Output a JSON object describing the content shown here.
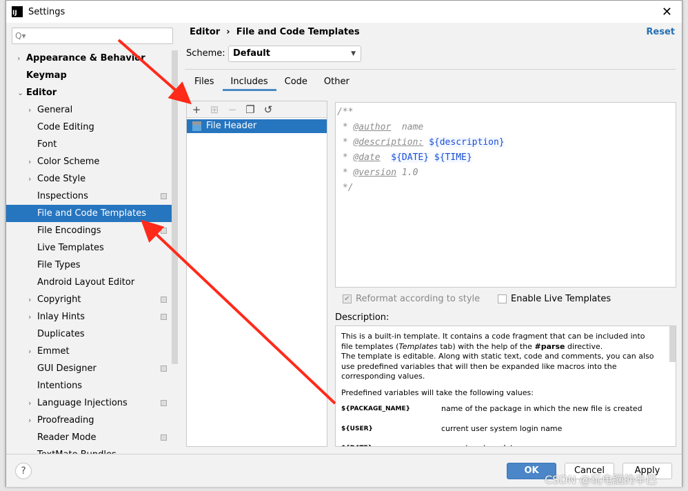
{
  "window": {
    "title": "Settings",
    "logo": "IJ"
  },
  "search": {
    "placeholder": "Q▾"
  },
  "tree": [
    {
      "label": "Appearance & Behavior",
      "level": 0,
      "arrow": "›",
      "bold": true
    },
    {
      "label": "Keymap",
      "level": 0,
      "bold": true
    },
    {
      "label": "Editor",
      "level": 0,
      "arrow": "⌄",
      "bold": true
    },
    {
      "label": "General",
      "level": 1,
      "arrow": "›"
    },
    {
      "label": "Code Editing",
      "level": 1
    },
    {
      "label": "Font",
      "level": 1
    },
    {
      "label": "Color Scheme",
      "level": 1,
      "arrow": "›"
    },
    {
      "label": "Code Style",
      "level": 1,
      "arrow": "›"
    },
    {
      "label": "Inspections",
      "level": 1,
      "badge": true
    },
    {
      "label": "File and Code Templates",
      "level": 1,
      "selected": true
    },
    {
      "label": "File Encodings",
      "level": 1,
      "badge": true
    },
    {
      "label": "Live Templates",
      "level": 1
    },
    {
      "label": "File Types",
      "level": 1
    },
    {
      "label": "Android Layout Editor",
      "level": 1
    },
    {
      "label": "Copyright",
      "level": 1,
      "arrow": "›",
      "badge": true
    },
    {
      "label": "Inlay Hints",
      "level": 1,
      "arrow": "›",
      "badge": true
    },
    {
      "label": "Duplicates",
      "level": 1
    },
    {
      "label": "Emmet",
      "level": 1,
      "arrow": "›"
    },
    {
      "label": "GUI Designer",
      "level": 1,
      "badge": true
    },
    {
      "label": "Intentions",
      "level": 1
    },
    {
      "label": "Language Injections",
      "level": 1,
      "arrow": "›",
      "badge": true
    },
    {
      "label": "Proofreading",
      "level": 1,
      "arrow": "›"
    },
    {
      "label": "Reader Mode",
      "level": 1,
      "badge": true
    },
    {
      "label": "TextMate Bundles",
      "level": 1
    }
  ],
  "header": {
    "crumb1": "Editor",
    "sep": "›",
    "crumb2": "File and Code Templates",
    "reset": "Reset"
  },
  "scheme": {
    "label": "Scheme:",
    "value": "Default"
  },
  "tabs": [
    {
      "label": "Files"
    },
    {
      "label": "Includes",
      "active": true
    },
    {
      "label": "Code"
    },
    {
      "label": "Other"
    }
  ],
  "toolbar": {
    "add": "+",
    "copy_add": "⊞",
    "remove": "−",
    "duplicate": "❐",
    "reset": "↺"
  },
  "templates": [
    {
      "label": "File Header"
    }
  ],
  "editor": {
    "l1": "/**",
    "star": "* ",
    "author_tag": "@author",
    "author_val": "  name",
    "desc_tag": "@description:",
    "desc_var": "${description}",
    "date_tag": "@date",
    "date_var": "${DATE}",
    "time_var": "${TIME}",
    "ver_tag": "@version",
    "ver_val": " 1.0",
    "end": "*/"
  },
  "options": {
    "reformat": "Reformat according to style",
    "reformat_checked": true,
    "live": "Enable Live Templates",
    "live_checked": false
  },
  "description": {
    "label": "Description:",
    "p1a": "This is a built-in template. It contains a code fragment that can be included into file templates (",
    "p1i": "Templates",
    "p1b": " tab) with the help of the ",
    "p1bold": "#parse",
    "p1c": " directive.",
    "p1d": "The template is editable. Along with static text, code and comments, you can also use predefined variables that will then be expanded like macros into the corresponding values.",
    "p2": "Predefined variables will take the following values:",
    "vars": [
      {
        "name": "${PACKAGE_NAME}",
        "desc": "name of the package in which the new file is created"
      },
      {
        "name": "${USER}",
        "desc": "current user system login name"
      },
      {
        "name": "${DATE}",
        "desc": "current system date"
      }
    ]
  },
  "footer": {
    "help": "?",
    "ok": "OK",
    "cancel": "Cancel",
    "apply": "Apply"
  },
  "watermark": "CSDN @玩电脑的辛巴",
  "colors": {
    "accent": "#2675bf",
    "ok": "#4a86c8",
    "annotation_arrow": "#ff2a1a"
  }
}
